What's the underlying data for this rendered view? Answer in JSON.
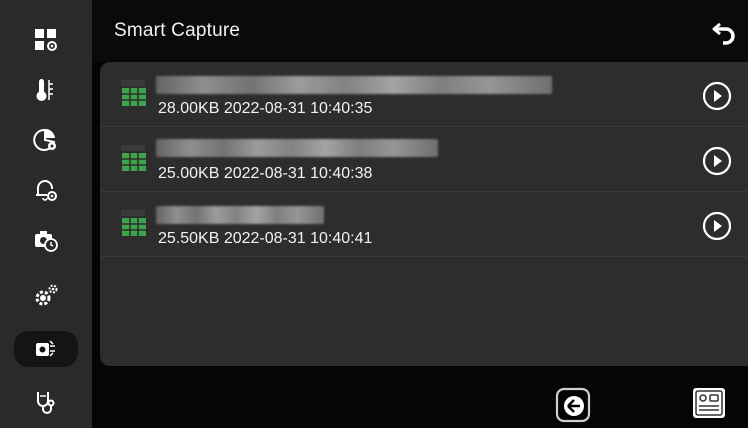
{
  "header": {
    "title": "Smart Capture"
  },
  "sidebar": {
    "items": [
      {
        "icon": "grid-settings-icon"
      },
      {
        "icon": "thermometer-icon"
      },
      {
        "icon": "palette-settings-icon"
      },
      {
        "icon": "alarm-bell-settings-icon"
      },
      {
        "icon": "camera-timer-icon"
      },
      {
        "icon": "gears-icon"
      },
      {
        "icon": "smart-capture-icon"
      },
      {
        "icon": "stethoscope-icon"
      }
    ]
  },
  "captures": [
    {
      "meta": "28.00KB 2022-08-31 10:40:35"
    },
    {
      "meta": "25.00KB 2022-08-31 10:40:38"
    },
    {
      "meta": "25.50KB 2022-08-31 10:40:41"
    }
  ],
  "colors": {
    "accent": "#3fa34d",
    "panel": "#2d2d2d",
    "sidebar": "#2a2a2a"
  }
}
